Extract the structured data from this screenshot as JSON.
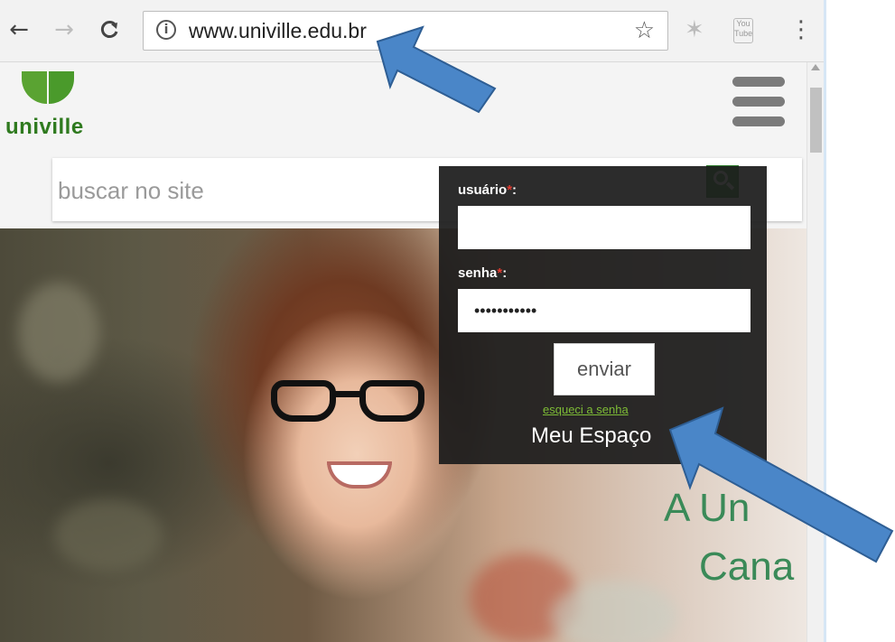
{
  "browser": {
    "back_icon": "arrow-left-icon",
    "forward_icon": "arrow-right-icon",
    "reload_icon": "reload-icon",
    "info_glyph": "i",
    "url": "www.univille.edu.br",
    "bookmark_icon": "star-icon",
    "youtube_ext_label": "You Tube",
    "menu_icon": "vertical-dots-icon"
  },
  "site": {
    "logo_text": "univille",
    "menu_icon": "hamburger-icon",
    "search": {
      "placeholder": "buscar no site",
      "button_icon": "magnifier-icon"
    }
  },
  "login": {
    "user_label": "usuário",
    "password_label": "senha",
    "required_mark": "*",
    "label_suffix": ":",
    "user_value": "",
    "password_value": "•••••••••••",
    "submit_label": "enviar",
    "forgot_link": "esqueci a senha",
    "area_title": "Meu Espaço"
  },
  "hero": {
    "text_line1": "A Un",
    "text_line2": "Cana"
  },
  "colors": {
    "brand_green": "#3a9a39",
    "login_bg": "#1c1c1c",
    "link_green": "#7dbb36",
    "annotation_blue": "#4a86c8"
  }
}
